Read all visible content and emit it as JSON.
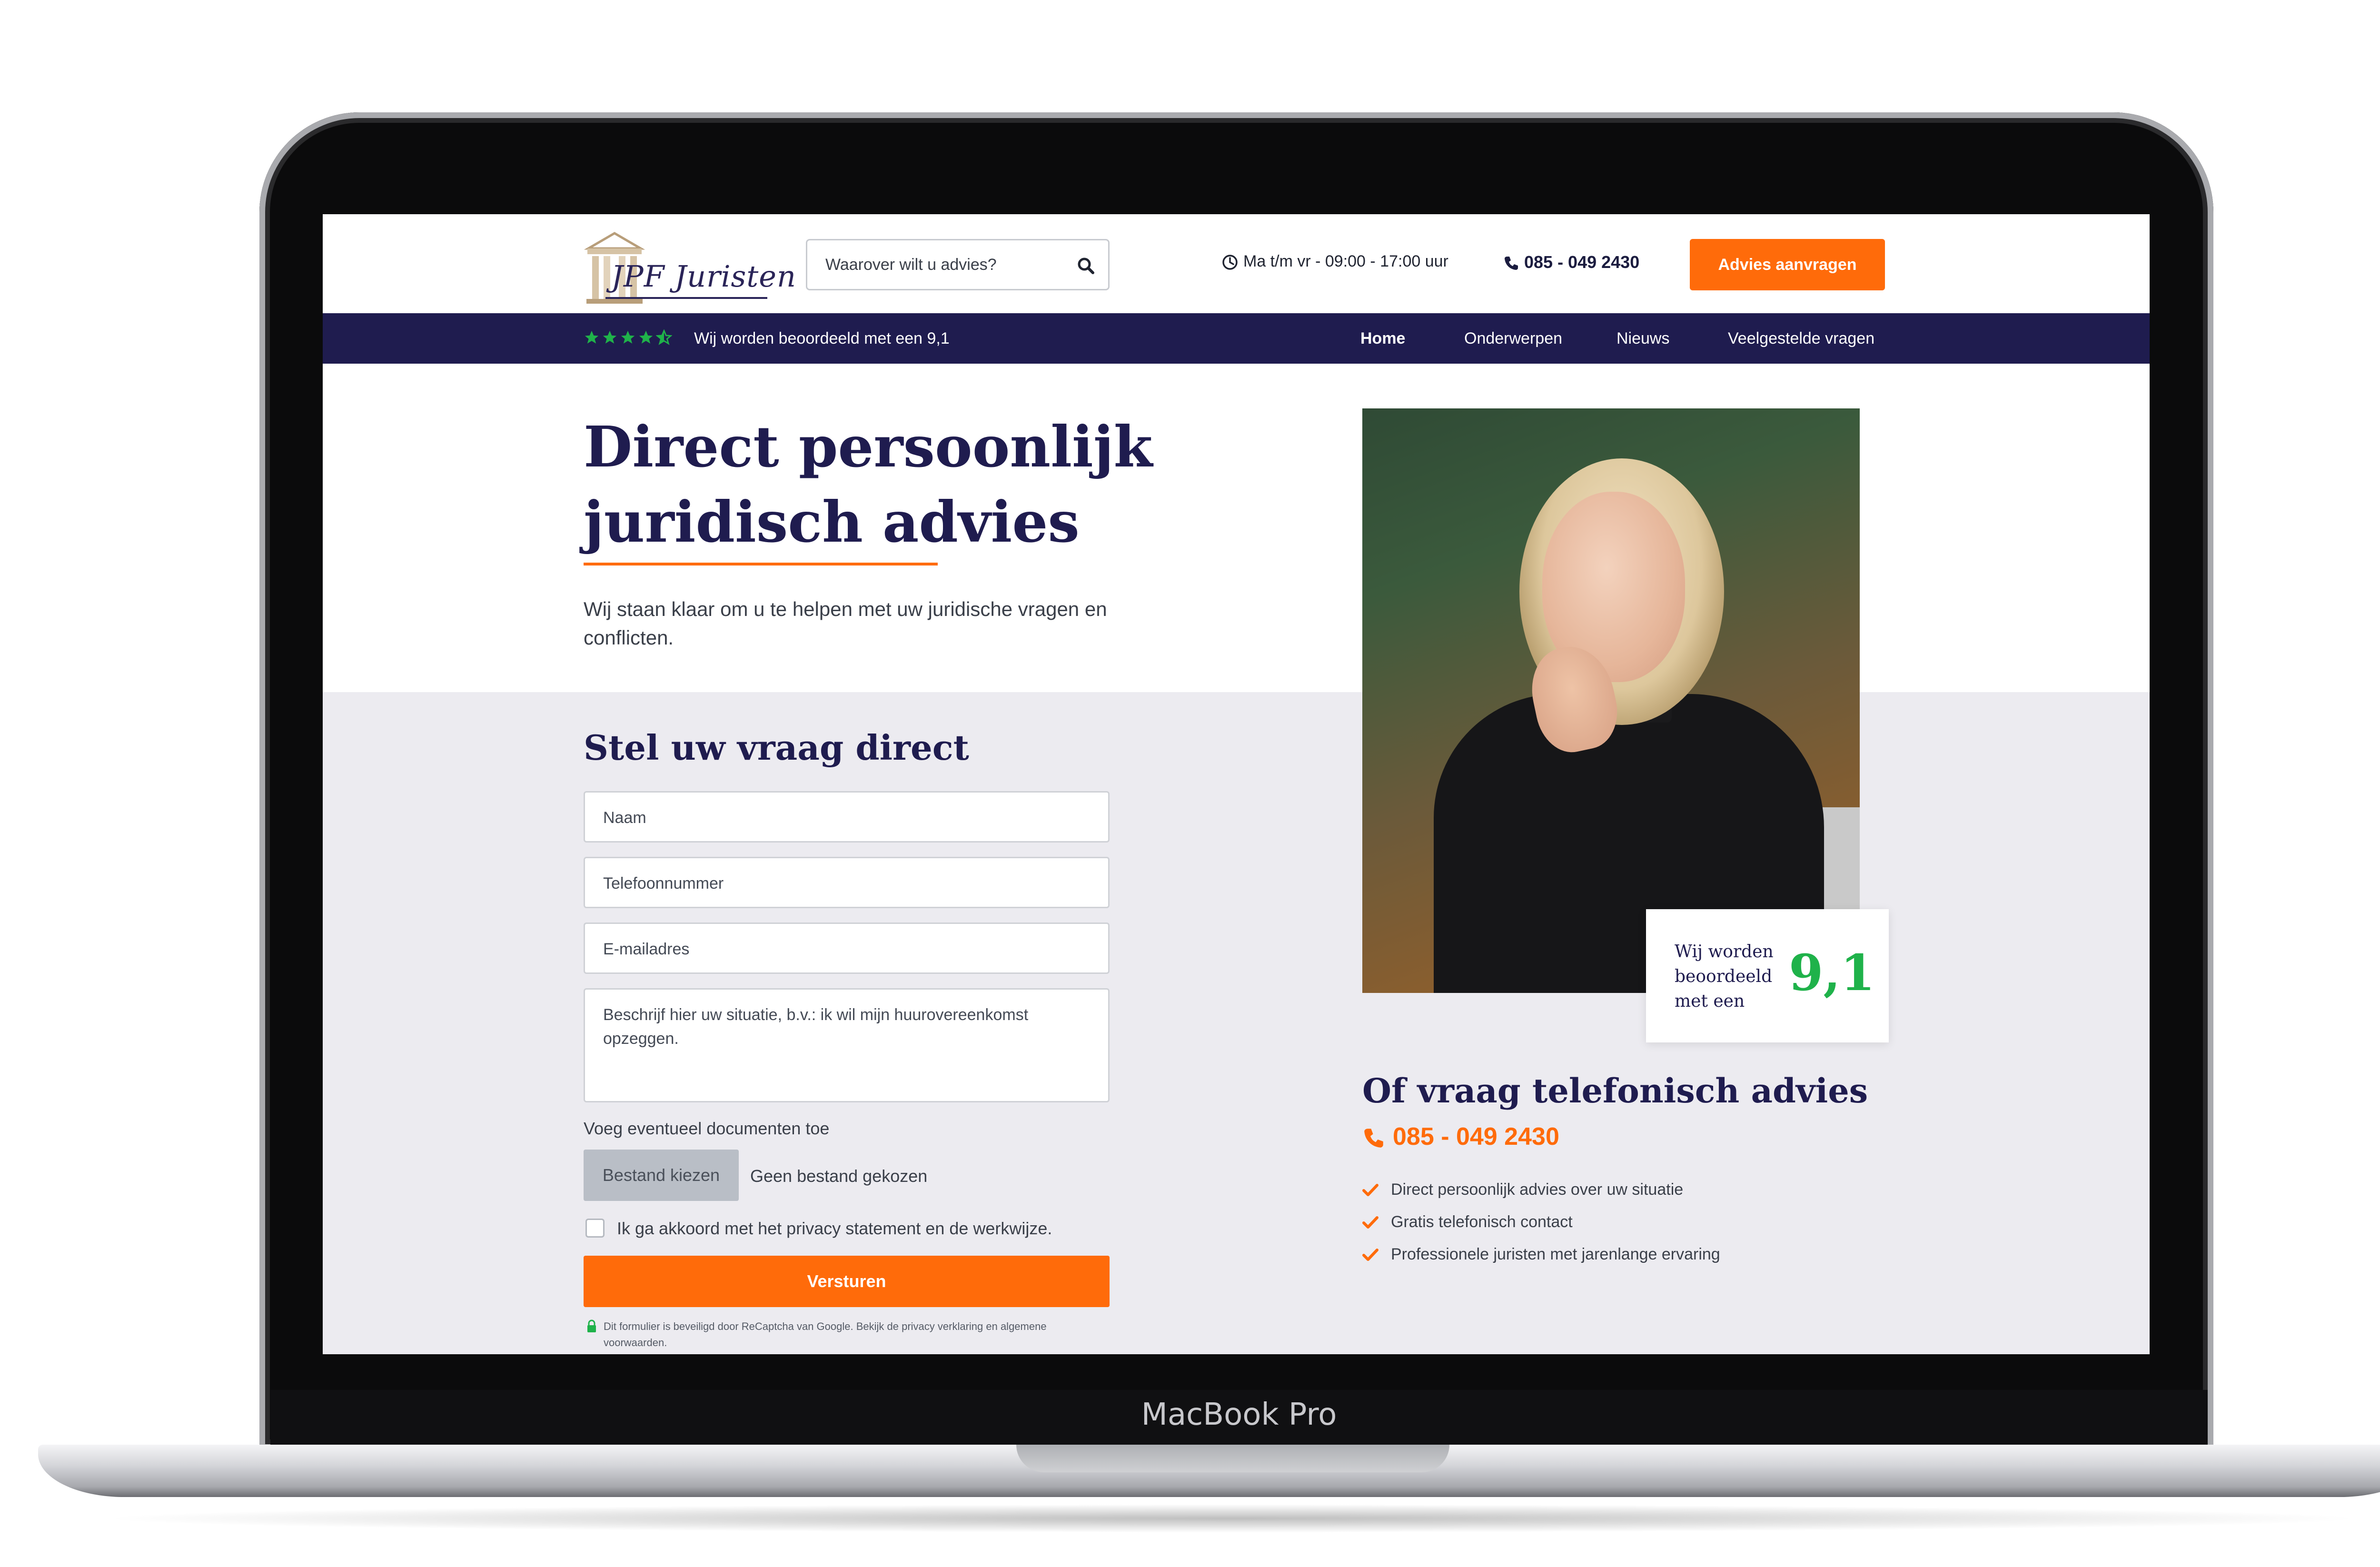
{
  "device": {
    "brand_label": "MacBook Pro"
  },
  "header": {
    "logo_text": "JPF Juristen",
    "search": {
      "placeholder": "Waarover wilt u advies?"
    },
    "hours": "Ma t/m vr - 09:00 - 17:00 uur",
    "phone": "085 - 049 2430",
    "cta": "Advies aanvragen"
  },
  "navbar": {
    "rating_stars": 4.5,
    "rating_text": "Wij worden beoordeeld met een 9,1",
    "items": [
      {
        "label": "Home",
        "active": true
      },
      {
        "label": "Onderwerpen",
        "active": false
      },
      {
        "label": "Nieuws",
        "active": false
      },
      {
        "label": "Veelgestelde vragen",
        "active": false
      }
    ]
  },
  "hero": {
    "title_line1": "Direct persoonlijk",
    "title_line2": "juridisch advies",
    "subtitle": "Wij staan klaar om u te helpen met uw juridische vragen en conflicten."
  },
  "form": {
    "title": "Stel uw vraag direct",
    "fields": {
      "name": "Naam",
      "phone": "Telefoonnummer",
      "email": "E-mailadres",
      "message": "Beschrijf hier uw situatie, b.v.: ik wil mijn huurovereenkomst opzeggen."
    },
    "upload_label": "Voeg eventueel documenten toe",
    "file_button": "Bestand kiezen",
    "file_status": "Geen bestand gekozen",
    "consent": "Ik ga akkoord met het privacy statement en de werkwijze.",
    "submit": "Versturen",
    "recaptcha_note": "Dit formulier is beveiligd door ReCaptcha van Google. Bekijk de privacy verklaring en algemene voorwaarden."
  },
  "rating_card": {
    "text": "Wij worden beoordeeld met een",
    "score": "9,1"
  },
  "phone_section": {
    "title": "Of vraag telefonisch advies",
    "phone": "085 - 049 2430",
    "benefits": [
      "Direct persoonlijk advies over uw situatie",
      "Gratis telefonisch contact",
      "Professionele juristen met jarenlange ervaring"
    ]
  },
  "colors": {
    "navy": "#1f1c4f",
    "accent_orange": "#ff6b0a",
    "rating_green": "#1fb24a",
    "form_background": "#ecebf0"
  }
}
